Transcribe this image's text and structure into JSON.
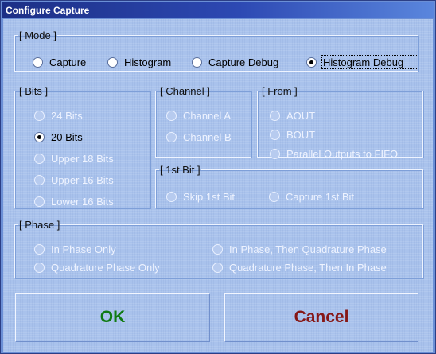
{
  "window": {
    "title": "Configure Capture"
  },
  "mode": {
    "legend": "[ Mode ]",
    "options": [
      {
        "label": "Capture",
        "checked": false
      },
      {
        "label": "Histogram",
        "checked": false
      },
      {
        "label": "Capture Debug",
        "checked": false
      },
      {
        "label": "Histogram Debug",
        "checked": true
      }
    ]
  },
  "bits": {
    "legend": "[ Bits ]",
    "options": [
      {
        "label": "24 Bits",
        "checked": false,
        "enabled": false
      },
      {
        "label": "20 Bits",
        "checked": true,
        "enabled": true
      },
      {
        "label": "Upper 18 Bits",
        "checked": false,
        "enabled": false
      },
      {
        "label": "Upper 16 Bits",
        "checked": false,
        "enabled": false
      },
      {
        "label": "Lower 16 Bits",
        "checked": false,
        "enabled": false
      }
    ]
  },
  "channel": {
    "legend": "[ Channel ]",
    "options": [
      {
        "label": "Channel A",
        "checked": false,
        "enabled": false
      },
      {
        "label": "Channel B",
        "checked": false,
        "enabled": false
      }
    ]
  },
  "from": {
    "legend": "[ From ]",
    "options": [
      {
        "label": "AOUT",
        "checked": false,
        "enabled": false
      },
      {
        "label": "BOUT",
        "checked": false,
        "enabled": false
      },
      {
        "label": "Parallel Outputs to FIFO",
        "checked": false,
        "enabled": false
      }
    ]
  },
  "first_bit": {
    "legend": "[ 1st Bit ]",
    "options": [
      {
        "label": "Skip 1st Bit",
        "checked": false,
        "enabled": false
      },
      {
        "label": "Capture 1st Bit",
        "checked": false,
        "enabled": false
      }
    ]
  },
  "phase": {
    "legend": "[ Phase ]",
    "options": [
      {
        "label": "In Phase Only",
        "checked": false,
        "enabled": false
      },
      {
        "label": "In Phase, Then Quadrature Phase",
        "checked": false,
        "enabled": false
      },
      {
        "label": "Quadrature Phase Only",
        "checked": false,
        "enabled": false
      },
      {
        "label": "Quadrature Phase, Then In Phase",
        "checked": false,
        "enabled": false
      }
    ]
  },
  "buttons": {
    "ok": "OK",
    "cancel": "Cancel"
  },
  "colors": {
    "title_bar": "#1c2f86",
    "client_bg": "#a9c2ec",
    "ok_text": "#0f7a12",
    "cancel_text": "#861716",
    "disabled_text": "#eef3ff"
  }
}
